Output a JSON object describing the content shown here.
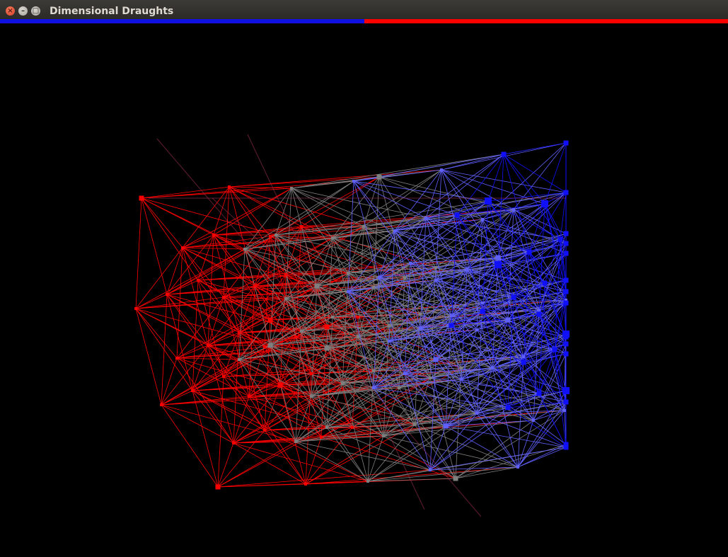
{
  "window": {
    "title": "Dimensional Draughts",
    "buttons": {
      "close": "close",
      "minimize": "minimize",
      "maximize": "maximize"
    }
  },
  "score_bar": {
    "blue_fraction": 0.5,
    "blue_color": "#1010e0",
    "red_color": "#ff0000"
  },
  "board": {
    "background": "#000000",
    "colors": {
      "red": "#ff0000",
      "gray": "#7f7f7f",
      "blue": "#1010ff",
      "light_blue": "#6060ff"
    },
    "regions": [
      "red",
      "gray",
      "light_blue",
      "blue"
    ]
  }
}
